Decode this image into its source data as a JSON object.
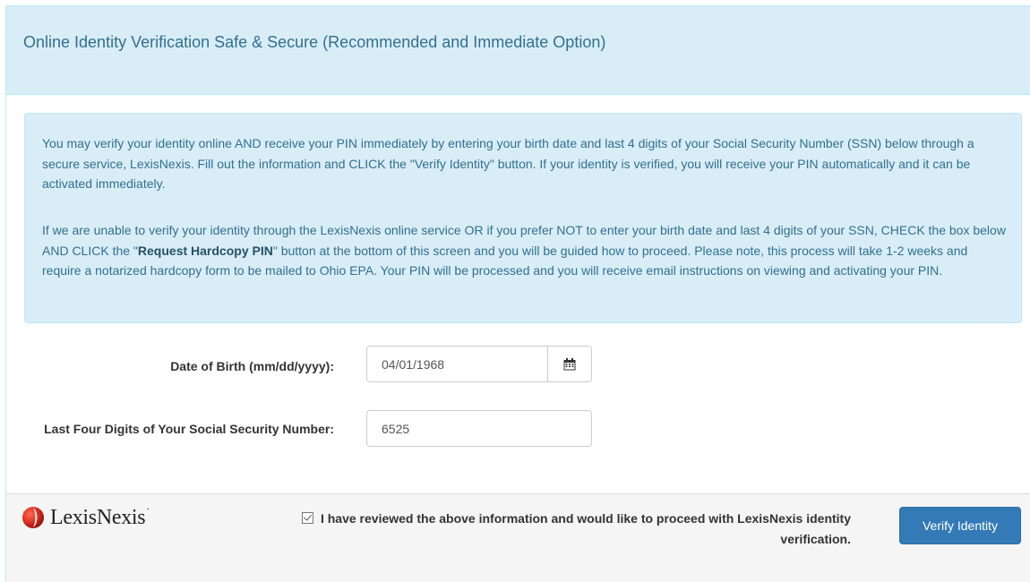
{
  "panel": {
    "title": "Online Identity Verification Safe & Secure (Recommended and Immediate Option)"
  },
  "info": {
    "paragraph1": "You may verify your identity online AND receive your PIN immediately by entering your birth date and last 4 digits of your Social Security Number (SSN) below through a secure service, LexisNexis. Fill out the information and CLICK the \"Verify Identity\" button. If your identity is verified, you will receive your PIN automatically and it can be activated immediately.",
    "paragraph2_before": "If we are unable to verify your identity through the LexisNexis online service OR if you prefer NOT to enter your birth date and last 4 digits of your SSN, CHECK the box below AND CLICK the \"",
    "paragraph2_bold": "Request Hardcopy PIN",
    "paragraph2_after": "\" button at the bottom of this screen and you will be guided how to proceed. Please note, this process will take 1-2 weeks and require a notarized hardcopy form to be mailed to Ohio EPA. Your PIN will be processed and you will receive email instructions on viewing and activating your PIN."
  },
  "form": {
    "dob_label": "Date of Birth (mm/dd/yyyy):",
    "dob_value": "04/01/1968",
    "ssn_label": "Last Four Digits of Your Social Security Number:",
    "ssn_value": "6525"
  },
  "footer": {
    "logo_text": "LexisNexis",
    "logo_mark": "·",
    "consent_text": "I have reviewed the above information and would like to proceed with LexisNexis identity verification.",
    "consent_checked": true,
    "verify_button": "Verify Identity"
  },
  "colors": {
    "info_bg": "#d9edf7",
    "info_text": "#31708f",
    "primary_button": "#337ab7",
    "logo_red": "#d62b1f"
  },
  "icons": {
    "calendar": "calendar-icon",
    "logo": "lexisnexis-logo-icon"
  }
}
